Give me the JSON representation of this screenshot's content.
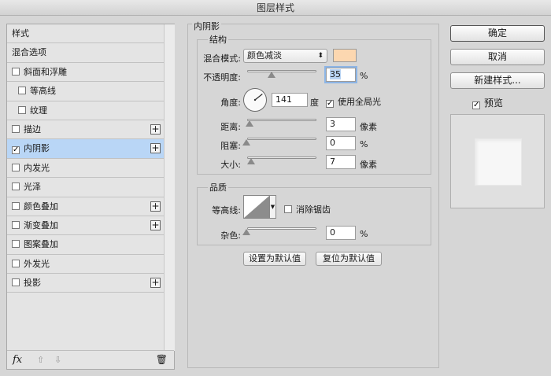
{
  "window": {
    "title": "图层样式"
  },
  "styles_list": {
    "header": "样式",
    "blend_options": "混合选项",
    "items": [
      {
        "label": "斜面和浮雕",
        "checked": false,
        "plus": false,
        "sub": false
      },
      {
        "label": "等高线",
        "checked": false,
        "plus": false,
        "sub": true
      },
      {
        "label": "纹理",
        "checked": false,
        "plus": false,
        "sub": true
      },
      {
        "label": "描边",
        "checked": false,
        "plus": true,
        "sub": false
      },
      {
        "label": "内阴影",
        "checked": true,
        "plus": true,
        "sub": false,
        "selected": true
      },
      {
        "label": "内发光",
        "checked": false,
        "plus": false,
        "sub": false
      },
      {
        "label": "光泽",
        "checked": false,
        "plus": false,
        "sub": false
      },
      {
        "label": "颜色叠加",
        "checked": false,
        "plus": true,
        "sub": false
      },
      {
        "label": "渐变叠加",
        "checked": false,
        "plus": true,
        "sub": false
      },
      {
        "label": "图案叠加",
        "checked": false,
        "plus": false,
        "sub": false
      },
      {
        "label": "外发光",
        "checked": false,
        "plus": false,
        "sub": false
      },
      {
        "label": "投影",
        "checked": false,
        "plus": true,
        "sub": false
      }
    ],
    "footer": {
      "fx": "fx"
    }
  },
  "inner_shadow": {
    "title": "内阴影",
    "structure": {
      "title": "结构",
      "blend_mode_label": "混合模式:",
      "blend_mode_value": "颜色减淡",
      "color": "#fcd7b0",
      "opacity_label": "不透明度:",
      "opacity_value": "35",
      "opacity_unit": "%",
      "angle_label": "角度:",
      "angle_value": "141",
      "angle_unit": "度",
      "global_light_label": "使用全局光",
      "global_light_checked": true,
      "distance_label": "距离:",
      "distance_value": "3",
      "distance_unit": "像素",
      "choke_label": "阻塞:",
      "choke_value": "0",
      "choke_unit": "%",
      "size_label": "大小:",
      "size_value": "7",
      "size_unit": "像素"
    },
    "quality": {
      "title": "品质",
      "contour_label": "等高线:",
      "antialias_label": "消除锯齿",
      "antialias_checked": false,
      "noise_label": "杂色:",
      "noise_value": "0",
      "noise_unit": "%"
    },
    "make_default": "设置为默认值",
    "reset_default": "复位为默认值"
  },
  "actions": {
    "ok": "确定",
    "cancel": "取消",
    "new_style": "新建样式...",
    "preview_label": "预览",
    "preview_checked": true
  }
}
